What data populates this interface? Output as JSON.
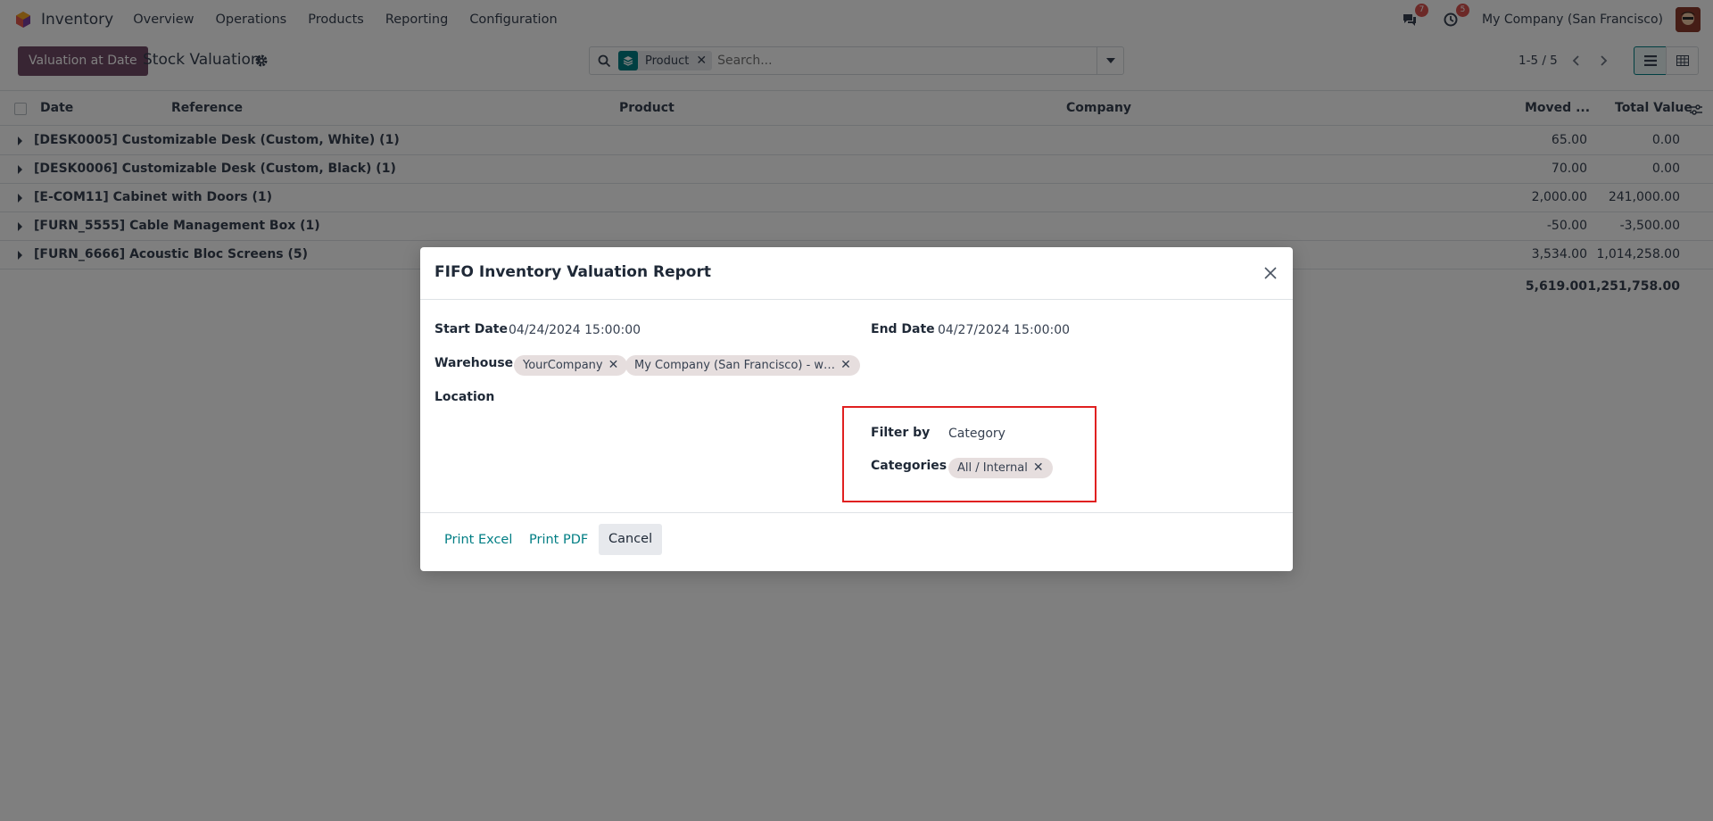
{
  "navbar": {
    "app_name": "Inventory",
    "menu": [
      "Overview",
      "Operations",
      "Products",
      "Reporting",
      "Configuration"
    ],
    "messages_count": "7",
    "activities_count": "5",
    "company": "My Company (San Francisco)"
  },
  "control_panel": {
    "action_button": "Valuation at Date",
    "title": "Stock Valuation",
    "facet_label": "Product",
    "search_placeholder": "Search...",
    "pager": "1-5 / 5"
  },
  "list": {
    "headers": {
      "date": "Date",
      "reference": "Reference",
      "product": "Product",
      "company": "Company",
      "moved": "Moved ...",
      "total_value": "Total Value"
    },
    "groups": [
      {
        "label": "[DESK0005] Customizable Desk (Custom, White) (1)",
        "moved": "65.00",
        "total": "0.00"
      },
      {
        "label": "[DESK0006] Customizable Desk (Custom, Black) (1)",
        "moved": "70.00",
        "total": "0.00"
      },
      {
        "label": "[E-COM11] Cabinet with Doors (1)",
        "moved": "2,000.00",
        "total": "241,000.00"
      },
      {
        "label": "[FURN_5555] Cable Management Box (1)",
        "moved": "-50.00",
        "total": "-3,500.00"
      },
      {
        "label": "[FURN_6666] Acoustic Bloc Screens (5)",
        "moved": "3,534.00",
        "total": "1,014,258.00"
      }
    ],
    "totals": {
      "moved": "5,619.00",
      "total": "1,251,758.00"
    }
  },
  "modal": {
    "title": "FIFO Inventory Valuation Report",
    "start_date_label": "Start Date",
    "start_date": "04/24/2024 15:00:00",
    "end_date_label": "End Date",
    "end_date": "04/27/2024 15:00:00",
    "warehouse_label": "Warehouse",
    "warehouses": [
      "YourCompany",
      "My Company (San Francisco) - w…"
    ],
    "location_label": "Location",
    "filter_by_label": "Filter by",
    "filter_by": "Category",
    "categories_label": "Categories",
    "categories": [
      "All / Internal"
    ],
    "print_excel": "Print Excel",
    "print_pdf": "Print PDF",
    "cancel": "Cancel"
  },
  "colors": {
    "brand": "#714B67",
    "link": "#017e84",
    "highlight": "#e02020",
    "badge": "#d9534f"
  }
}
